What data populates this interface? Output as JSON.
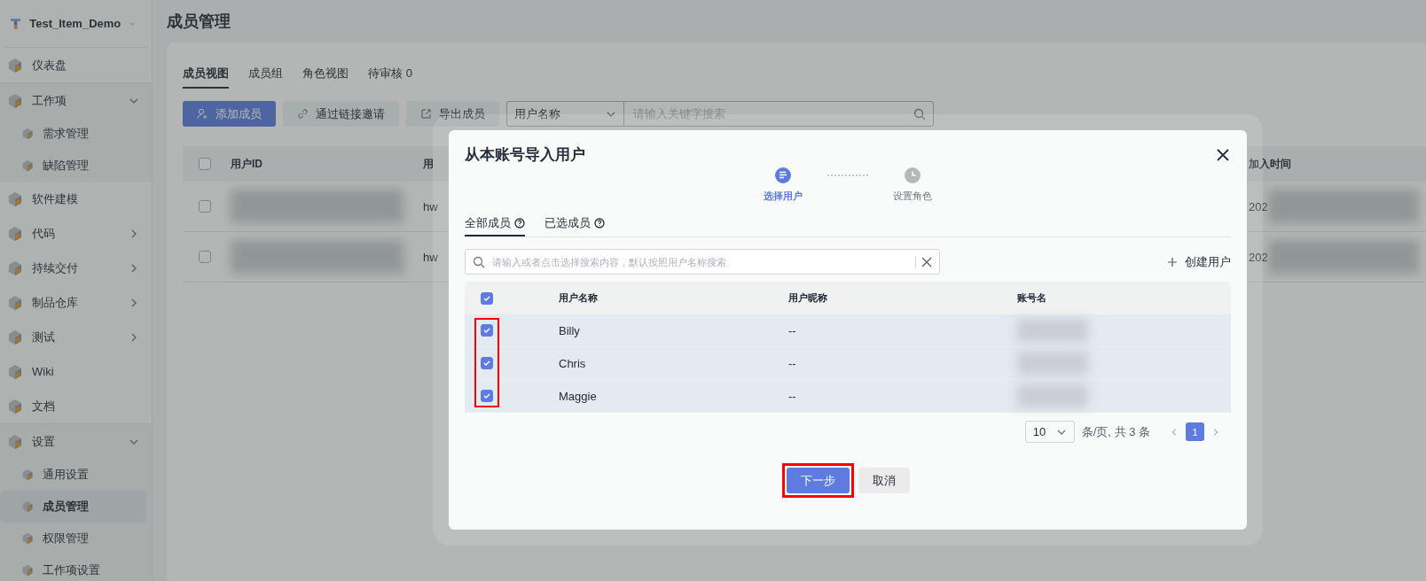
{
  "sidebar": {
    "project": "Test_Item_Demo",
    "items": [
      {
        "label": "仪表盘",
        "kind": "item",
        "selected": false
      },
      {
        "label": "工作项",
        "kind": "group",
        "expanded": true,
        "children": [
          {
            "label": "需求管理",
            "selected": false
          },
          {
            "label": "缺陷管理",
            "selected": false
          }
        ]
      },
      {
        "label": "软件建模",
        "kind": "item",
        "selected": false
      },
      {
        "label": "代码",
        "kind": "group",
        "expanded": false
      },
      {
        "label": "持续交付",
        "kind": "group",
        "expanded": false
      },
      {
        "label": "制品仓库",
        "kind": "group",
        "expanded": false
      },
      {
        "label": "测试",
        "kind": "group",
        "expanded": false
      },
      {
        "label": "Wiki",
        "kind": "item",
        "selected": false
      },
      {
        "label": "文档",
        "kind": "item",
        "selected": false
      },
      {
        "label": "设置",
        "kind": "group",
        "expanded": true,
        "children": [
          {
            "label": "通用设置",
            "selected": false
          },
          {
            "label": "成员管理",
            "selected": true
          },
          {
            "label": "权限管理",
            "selected": false
          },
          {
            "label": "工作项设置",
            "selected": false
          }
        ]
      }
    ]
  },
  "page": {
    "title": "成员管理",
    "tabs": [
      {
        "label": "成员视图",
        "selected": true
      },
      {
        "label": "成员组",
        "selected": false
      },
      {
        "label": "角色视图",
        "selected": false
      },
      {
        "label": "待审核",
        "count": "0",
        "selected": false
      }
    ],
    "toolbar": {
      "buttons": [
        {
          "label": "添加成员",
          "kind": "primary"
        },
        {
          "label": "通过链接邀请",
          "kind": "link"
        },
        {
          "label": "导出成员",
          "kind": "export"
        }
      ],
      "filter": {
        "value": "用户名称"
      },
      "search": {
        "placeholder": "请输入关键字搜索"
      }
    },
    "table": {
      "columns": [
        "用户ID",
        "用",
        "加入时间"
      ],
      "all_checked": false,
      "rows": [
        {
          "checked": false,
          "column_3": "hw",
          "joined": "202"
        },
        {
          "checked": false,
          "column_3": "hw",
          "joined": "202"
        }
      ]
    }
  },
  "dialog": {
    "title": "从本账号导入用户",
    "steps": [
      {
        "label": "选择用户",
        "selected": true
      },
      {
        "label": "设置角色",
        "selected": false
      }
    ],
    "tabs": [
      {
        "label": "全部成员",
        "selected": true
      },
      {
        "label": "已选成员",
        "selected": false
      }
    ],
    "search": {
      "placeholder": "请输入或者点击选择搜索内容，默认按照用户名称搜索"
    },
    "create_button": "创建用户",
    "table": {
      "columns": [
        "用户名称",
        "用户昵称",
        "账号名"
      ],
      "all_checked": true,
      "checkbox_column_highlighted": true,
      "rows": [
        {
          "name": "Billy",
          "nickname": "--",
          "checked": true
        },
        {
          "name": "Chris",
          "nickname": "--",
          "checked": true
        },
        {
          "name": "Maggie",
          "nickname": "--",
          "checked": true
        }
      ]
    },
    "pagination": {
      "page_size": "10",
      "summary": "条/页, 共 3 条",
      "pages": [
        {
          "label": "1",
          "selected": true
        }
      ]
    },
    "buttons": [
      {
        "label": "下一步",
        "kind": "primary",
        "highlighted": true
      },
      {
        "label": "取消",
        "kind": "secondary",
        "highlighted": false
      }
    ]
  }
}
